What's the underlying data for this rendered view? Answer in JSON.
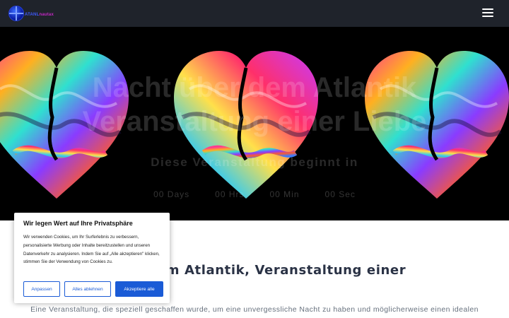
{
  "header": {
    "logo_main": "ATANL",
    "logo_accent": "nautax",
    "menu_icon": "hamburger-menu-icon"
  },
  "hero": {
    "title_line1": "Nacht über dem Atlantik",
    "title_line2": "Veranstaltung einer Liebe",
    "subtitle": "Diese Veranstaltung beginnt in",
    "countdown": [
      "00 Days",
      "00 Hrs",
      "00 Min",
      "00 Sec"
    ],
    "image": "colorful-heart-faces-artwork"
  },
  "content": {
    "heading": "ber dem Atlantik, Veranstaltung einer",
    "text": "Eine Veranstaltung, die speziell geschaffen wurde, um eine unvergessliche Nacht zu haben und möglicherweise einen idealen"
  },
  "cookie": {
    "title": "Wir legen Wert auf Ihre Privatsphäre",
    "body": "Wir verwenden Cookies, um Ihr Surferlebnis zu verbessern, personalisierte Werbung oder Inhalte bereitzustellen und unseren Datenverkehr zu analysieren. Indem Sie auf „Alle akzeptieren\" klicken, stimmen Sie der Verwendung von Cookies zu.",
    "btn_customize": "Anpassen",
    "btn_reject": "Alles ablehnen",
    "btn_accept": "Akzeptiere alle"
  },
  "colors": {
    "header_bg": "#1f232b",
    "hero_bg": "#000000",
    "button_blue": "#1a5bd6",
    "heading": "#2a3245"
  }
}
